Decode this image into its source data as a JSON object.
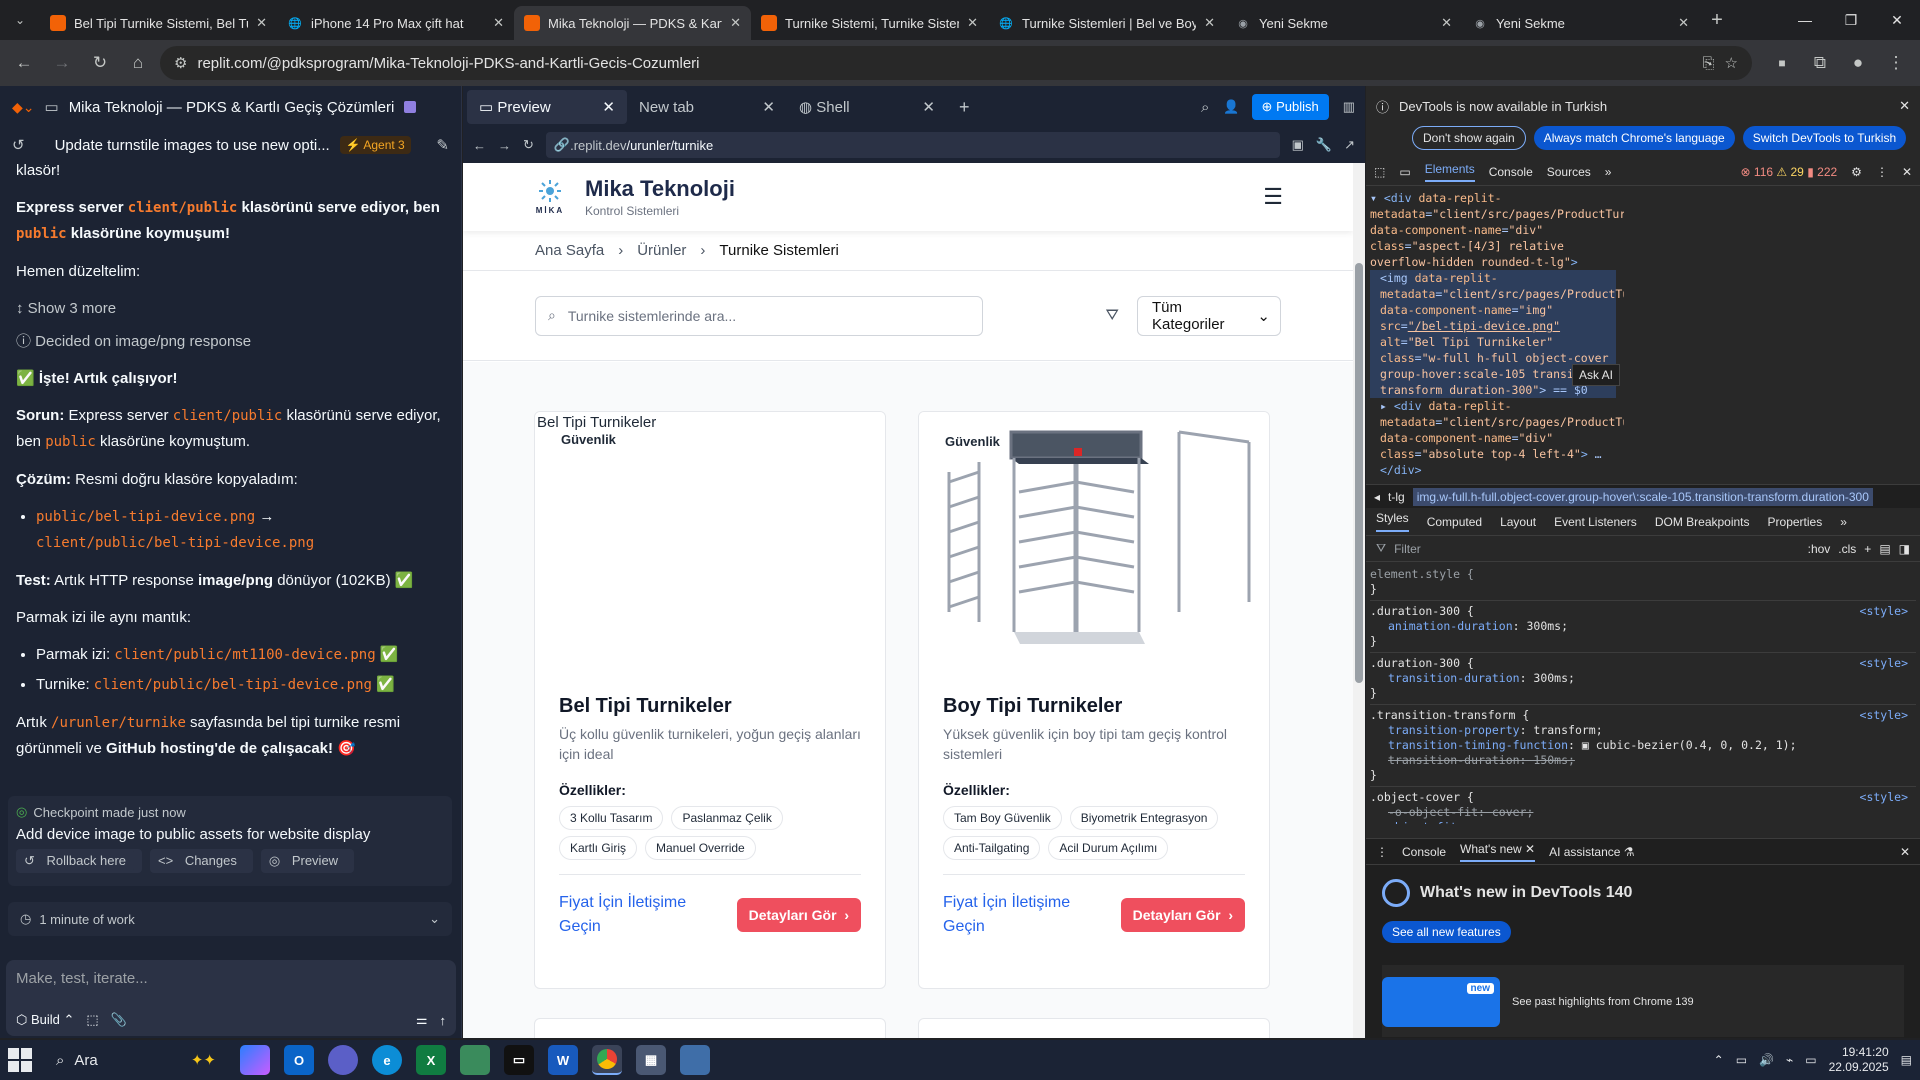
{
  "browser": {
    "tabs": [
      {
        "title": "Bel Tipi Turnike Sistemi, Bel Tur",
        "icon": "replit-favicon",
        "color": "#f26207",
        "active": false
      },
      {
        "title": "iPhone 14 Pro Max çift hat",
        "icon": "globe-favicon",
        "color": "#9aa0a6",
        "active": false
      },
      {
        "title": "Mika Teknoloji — PDKS & Kartl",
        "icon": "replit-favicon",
        "color": "#f26207",
        "active": true
      },
      {
        "title": "Turnike Sistemi, Turnike Sistem",
        "icon": "replit-favicon",
        "color": "#f26207",
        "active": false
      },
      {
        "title": "Turnike Sistemleri | Bel ve Boy T",
        "icon": "globe-favicon",
        "color": "#9aa0a6",
        "active": false
      },
      {
        "title": "Yeni Sekme",
        "icon": "chrome-favicon",
        "color": "#9aa0a6",
        "active": false
      },
      {
        "title": "Yeni Sekme",
        "icon": "chrome-favicon",
        "color": "#9aa0a6",
        "active": false
      }
    ],
    "url": "replit.com/@pdksprogram/Mika-Teknoloji-PDKS-and-Kartli-Gecis-Cozumleri"
  },
  "replit": {
    "project_title": "Mika Teknoloji — PDKS & Kartlı Geçiş Çözümleri",
    "thread_title": "Update turnstile images to use new opti...",
    "agent_badge": "Agent 3",
    "chat": {
      "top_fragment": "klasör!",
      "p1_a": "Express server ",
      "p1_code1": "client/public",
      "p1_b": " klasörünü serve ediyor, ben ",
      "p1_code2": "public",
      "p1_c": " klasörüne koymuşum!",
      "p2": "Hemen düzeltelim:",
      "show_more": "Show 3 more",
      "decided": "Decided on image/png response",
      "works": "✅ İşte! Artık çalışıyor!",
      "sorun_label": "Sorun:",
      "sorun_a": " Express server ",
      "sorun_code1": "client/public",
      "sorun_b": " klasörünü serve ediyor, ben ",
      "sorun_code2": "public",
      "sorun_c": " klasörüne koymuştum.",
      "cozum_label": "Çözüm:",
      "cozum_text": " Resmi doğru klasöre kopyaladım:",
      "copy_from": "public/bel-tipi-device.png",
      "arrow": " →",
      "copy_to": "client/public/bel-tipi-device.png",
      "test_label": "Test:",
      "test_a": " Artık HTTP response ",
      "test_b": "image/png",
      "test_c": " dönüyor (102KB) ✅",
      "logic": "Parmak izi ile aynı mantık:",
      "fp_label": "Parmak izi: ",
      "fp_path": "client/public/mt1100-device.png",
      "fp_ok": " ✅",
      "tr_label": "Turnike: ",
      "tr_path": "client/public/bel-tipi-device.png",
      "tr_ok": " ✅",
      "final_a": "Artık ",
      "final_code": "/urunler/turnike",
      "final_b": " sayfasında bel tipi turnike resmi görünmeli ve ",
      "final_bold": "GitHub hosting'de de çalışacak!",
      "final_emoji": " 🎯"
    },
    "checkpoint": {
      "status": "Checkpoint made just now",
      "title": "Add device image to public assets for website display",
      "rollback": "Rollback here",
      "changes": "Changes",
      "preview": "Preview"
    },
    "work": "1 minute of work",
    "composer": {
      "placeholder": "Make, test, iterate...",
      "mode": "Build"
    },
    "pane_tabs": [
      "Preview",
      "New tab",
      "Shell"
    ],
    "publish": "Publish",
    "preview_url_prefix": ".replit.dev",
    "preview_url_path": "/urunler/turnike"
  },
  "site": {
    "brand": "Mika Teknoloji",
    "brand_sub": "Kontrol Sistemleri",
    "logo_text": "MİKA",
    "breadcrumb": [
      "Ana Sayfa",
      "Ürünler",
      "Turnike Sistemleri"
    ],
    "search_placeholder": "Turnike sistemlerinde ara...",
    "category_select": "Tüm Kategoriler",
    "products": [
      {
        "broken_alt": "Bel Tipi Turnikeler",
        "badge": "Güvenlik",
        "title": "Bel Tipi Turnikeler",
        "desc": "Üç kollu güvenlik turnikeleri, yoğun geçiş alanları için ideal",
        "features_label": "Özellikler:",
        "features": [
          "3 Kollu Tasarım",
          "Paslanmaz Çelik",
          "Kartlı Giriş",
          "Manuel Override"
        ],
        "price": "Fiyat İçin İletişime Geçin",
        "detail": "Detayları Gör"
      },
      {
        "badge": "Güvenlik",
        "title": "Boy Tipi Turnikeler",
        "desc": "Yüksek güvenlik için boy tipi tam geçiş kontrol sistemleri",
        "features_label": "Özellikler:",
        "features": [
          "Tam Boy Güvenlik",
          "Biyometrik Entegrasyon",
          "Anti-Tailgating",
          "Acil Durum Açılımı"
        ],
        "price": "Fiyat İçin İletişime Geçin",
        "detail": "Detayları Gör"
      }
    ]
  },
  "devtools": {
    "banner": "DevTools is now available in Turkish",
    "btn_dont_show": "Don't show again",
    "btn_match": "Always match Chrome's language",
    "btn_switch": "Switch DevTools to Turkish",
    "tabs": [
      "Elements",
      "Console",
      "Sources"
    ],
    "errors": "116",
    "warnings": "29",
    "issues": "222",
    "ask_ai": "Ask AI",
    "path_left": "t-lg",
    "path_selected": "img.w-full.h-full.object-cover.group-hover\\:scale-105.transition-transform.duration-300",
    "style_tabs": [
      "Styles",
      "Computed",
      "Layout",
      "Event Listeners",
      "DOM Breakpoints",
      "Properties"
    ],
    "filter": "Filter",
    "hov": ":hov",
    "cls": ".cls",
    "drawer_tabs": [
      "Console",
      "What's new",
      "AI assistance"
    ],
    "whats_new_title": "What's new in DevTools 140",
    "see_all": "See all new features",
    "new_badge": "new",
    "past": "See past highlights from Chrome 139"
  },
  "taskbar": {
    "search": "Ara",
    "time": "19:41:20",
    "date": "22.09.2025"
  }
}
